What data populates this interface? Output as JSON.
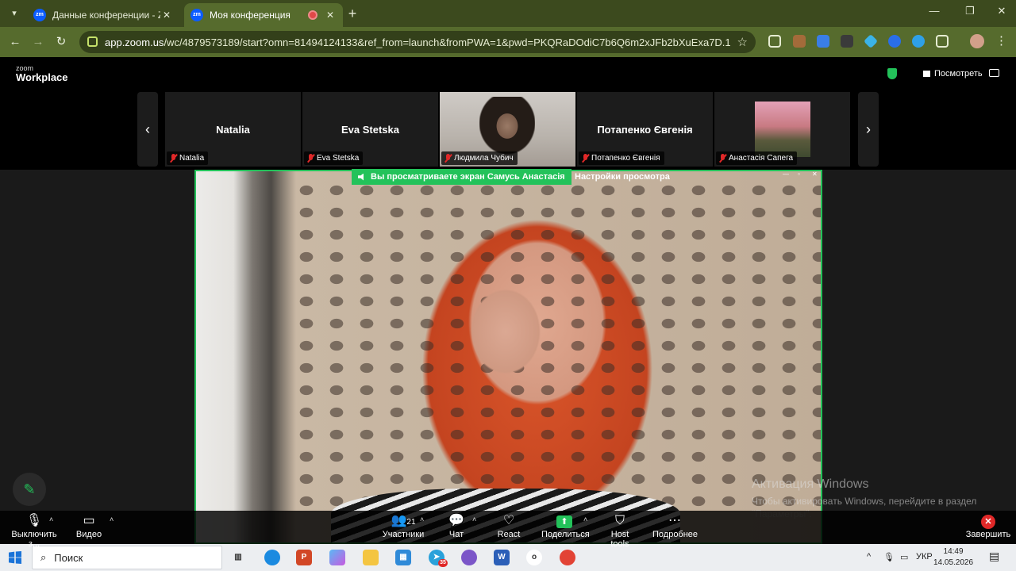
{
  "browser": {
    "tabs": [
      {
        "title": "Данные конференции - Zoom",
        "icon": "zm"
      },
      {
        "title": "Моя конференция",
        "icon": "zm"
      }
    ],
    "new_tab": "+",
    "url_host": "app.zoom.us",
    "url_path": "/wc/4879573189/start?omn=81494124133&ref_from=launch&fromPWA=1&pwd=PKQRaDOdiC7b6Q6m2xJFb2bXuExa7D.1"
  },
  "zoom": {
    "brand_small": "zoom",
    "brand_big": "Workplace",
    "view_label": "Посмотреть",
    "gallery": [
      {
        "display": "Natalia",
        "label": "Natalia"
      },
      {
        "display": "Eva Stetska",
        "label": "Eva Stetska"
      },
      {
        "display": "",
        "label": "Людмила Чубич"
      },
      {
        "display": "Потапенко Євгенія",
        "label": "Потапенко Євгенія"
      },
      {
        "display": "",
        "label": "Анастасія Сапега"
      }
    ],
    "share_banner": "Вы просматриваете экран  Самусь Анастасія",
    "view_settings": "Настройки просмотра",
    "toolbar": {
      "mute": "Выключить з...",
      "video": "Видео",
      "participants": "Участники",
      "participants_count": "21",
      "chat": "Чат",
      "react": "React",
      "share": "Поделиться",
      "host_tools": "Host tools",
      "more": "Подробнее",
      "end": "Завершить"
    }
  },
  "watermark": {
    "line1": "Активация Windows",
    "line2": "Чтобы активировать Windows, перейдите в раздел \"Параметры\"."
  },
  "taskbar": {
    "search_placeholder": "Поиск",
    "lang": "УКР",
    "time": "14:49",
    "date": "14.05.2026",
    "badge": "35"
  },
  "colors": {
    "accent": "#23c25a",
    "browser_frame": "#566b2d",
    "danger": "#e02828"
  }
}
